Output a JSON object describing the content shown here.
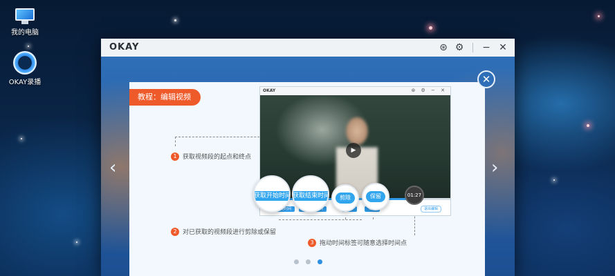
{
  "desktop": {
    "icons": [
      {
        "label": "我的电脑",
        "icon": "computer-icon"
      },
      {
        "label": "OKAY录播",
        "icon": "okay-recorder-icon"
      }
    ]
  },
  "window": {
    "brand": "OKAY",
    "titlebar_icons": [
      "webcam-icon",
      "gear-icon",
      "minimize-icon",
      "close-icon"
    ],
    "minimize_glyph": "−",
    "close_glyph": "✕",
    "gear_glyph": "⚙",
    "webcam_glyph": "⊛",
    "nav_prev": "‹",
    "nav_next": "›"
  },
  "tutorial": {
    "tag": "教程：编辑视频",
    "close_glyph": "✕",
    "steps": [
      {
        "num": "1",
        "text": "获取视频段的起点和终点"
      },
      {
        "num": "2",
        "text": "对已获取的视频段进行剪除或保留"
      },
      {
        "num": "3",
        "text": "拖动时间标签可随意选择时间点"
      }
    ],
    "zoom_labels": {
      "start": "获取开始时间",
      "end": "获取结束时间",
      "cut": "剪除",
      "keep": "保留",
      "time": "01:27"
    },
    "mini_window": {
      "brand": "OKAY",
      "icons": "⊛ ⚙ − ✕",
      "play_glyph": "▶",
      "progress": 0.81,
      "buttons": [
        "获取开始时间",
        "获取结束时间",
        "剪除",
        "保留",
        "退出编辑"
      ]
    },
    "pager": {
      "count": 3,
      "active_index": 2
    }
  }
}
